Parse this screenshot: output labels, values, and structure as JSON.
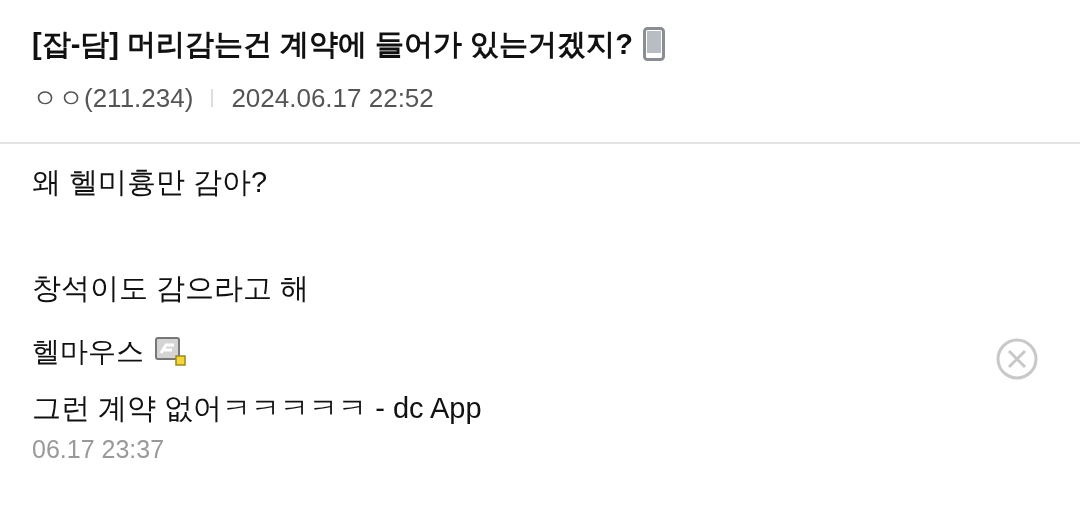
{
  "post": {
    "title": "[잡-담] 머리감는건 계약에 들어가 있는거겠지?",
    "author": "ㅇㅇ(211.234)",
    "date": "2024.06.17 22:52",
    "body": [
      "왜 헬미흉만 감아?",
      "창석이도 감으라고 해"
    ]
  },
  "comments": [
    {
      "author": "헬마우스",
      "text": "그런 계약 없어ㅋㅋㅋㅋㅋ - dc App",
      "time": "06.17 23:37"
    }
  ]
}
